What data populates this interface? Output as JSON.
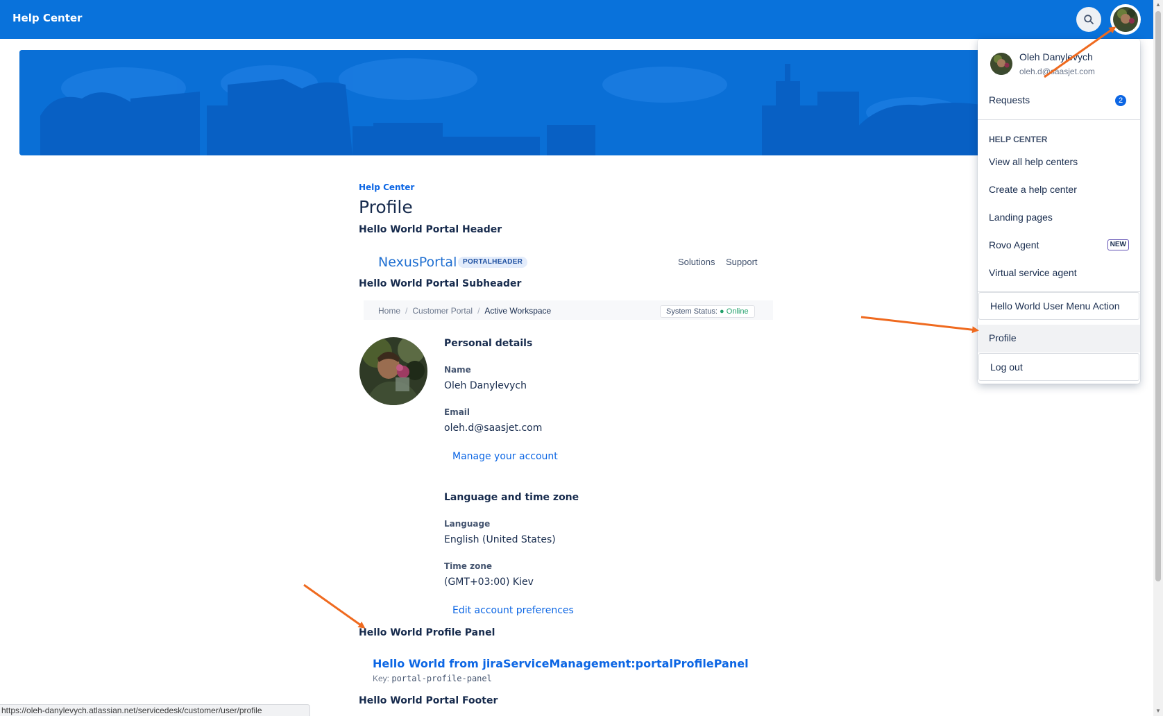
{
  "header": {
    "brand": "Help Center",
    "search_icon": "search-icon",
    "avatar_icon": "user-avatar"
  },
  "colors": {
    "topbar": "#0972db",
    "banner": "#0a6fd6",
    "link": "#0c66e4",
    "annotation_arrow": "#ef6a1f",
    "online": "#22a06b"
  },
  "main": {
    "breadcrumb": "Help Center",
    "title": "Profile",
    "portal_header_heading": "Hello World Portal Header",
    "portal_logo": "NexusPortal",
    "portal_badge": "PORTALHEADER",
    "portal_nav": [
      "Solutions",
      "Support"
    ],
    "portal_subheader_heading": "Hello World Portal Subheader",
    "subnav": {
      "crumbs": [
        "Home",
        "Customer Portal",
        "Active Workspace"
      ],
      "separator": "/",
      "status_label": "System Status:",
      "status_dot": "●",
      "status_value": "Online"
    },
    "personal_details": {
      "heading": "Personal details",
      "name_label": "Name",
      "name_value": "Oleh Danylevych",
      "email_label": "Email",
      "email_value": "oleh.d@saasjet.com",
      "manage_link": "Manage your account"
    },
    "language_time": {
      "heading": "Language and time zone",
      "language_label": "Language",
      "language_value": "English (United States)",
      "timezone_label": "Time zone",
      "timezone_value": "(GMT+03:00) Kiev",
      "edit_link": "Edit account preferences"
    },
    "profile_panel_heading": "Hello World Profile Panel",
    "profile_panel_link": "Hello World from jiraServiceManagement:portalProfilePanel",
    "profile_panel_key_label": "Key:",
    "profile_panel_key": "portal-profile-panel",
    "portal_footer_heading": "Hello World Portal Footer"
  },
  "status_bar_url": "https://oleh-danylevych.atlassian.net/servicedesk/customer/user/profile",
  "user_menu": {
    "user_name": "Oleh Danylevych",
    "user_email": "oleh.d@saasjet.com",
    "requests_label": "Requests",
    "requests_count": "2",
    "group_heading": "HELP CENTER",
    "items": [
      "View all help centers",
      "Create a help center",
      "Landing pages",
      "Rovo Agent",
      "Virtual service agent"
    ],
    "new_badge": "NEW",
    "custom_action": "Hello World User Menu Action",
    "profile": "Profile",
    "logout": "Log out"
  }
}
